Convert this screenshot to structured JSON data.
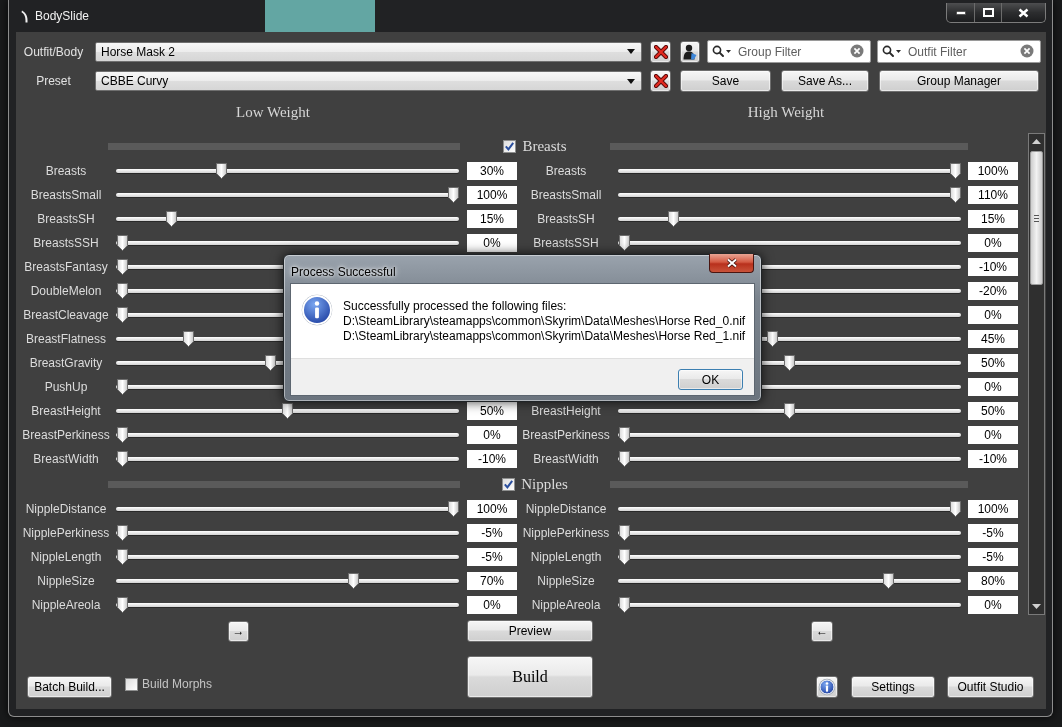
{
  "window": {
    "title": "BodySlide"
  },
  "outfit": {
    "label": "Outfit/Body",
    "value": "Horse Mask 2"
  },
  "filters": [
    {
      "placeholder": "Group Filter"
    },
    {
      "placeholder": "Outfit Filter"
    }
  ],
  "preset": {
    "label": "Preset",
    "value": "CBBE Curvy"
  },
  "preset_buttons": [
    "Save",
    "Save As...",
    "Group Manager"
  ],
  "columns": [
    "Low Weight",
    "High Weight"
  ],
  "categories": [
    {
      "name": "Breasts",
      "checked": true,
      "sliders": [
        {
          "low": {
            "label": "Breasts",
            "value": "30%",
            "level": 0.3
          },
          "high": {
            "label": "Breasts",
            "value": "100%",
            "level": 1
          }
        },
        {
          "low": {
            "label": "BreastsSmall",
            "value": "100%",
            "level": 1
          },
          "high": {
            "label": "BreastsSmall",
            "value": "110%",
            "level": 1
          }
        },
        {
          "low": {
            "label": "BreastsSH",
            "value": "15%",
            "level": 0.15
          },
          "high": {
            "label": "BreastsSH",
            "value": "15%",
            "level": 0.15
          }
        },
        {
          "low": {
            "label": "BreastsSSH",
            "value": "0%",
            "level": 0
          },
          "high": {
            "label": "BreastsSSH",
            "value": "0%",
            "level": 0
          }
        },
        {
          "low": {
            "label": "BreastsFantasy",
            "level": 0
          },
          "high": {
            "value": "-10%"
          }
        },
        {
          "low": {
            "label": "DoubleMelon",
            "level": 0
          },
          "high": {
            "value": "-20%"
          }
        },
        {
          "low": {
            "label": "BreastCleavage",
            "level": 0
          },
          "high": {
            "value": "0%"
          }
        },
        {
          "low": {
            "label": "BreastFlatness",
            "level": 0.2
          },
          "high": {
            "value": "45%",
            "level": 0.45
          }
        },
        {
          "low": {
            "label": "BreastGravity",
            "level": 0.45
          },
          "high": {
            "value": "50%",
            "level": 0.5
          }
        },
        {
          "low": {
            "label": "PushUp",
            "level": 0
          },
          "high": {
            "value": "0%"
          }
        },
        {
          "low": {
            "label": "BreastHeight",
            "value": "50%",
            "level": 0.5
          },
          "high": {
            "label": "BreastHeight",
            "value": "50%",
            "level": 0.5
          }
        },
        {
          "low": {
            "label": "BreastPerkiness",
            "value": "0%",
            "level": 0
          },
          "high": {
            "label": "BreastPerkiness",
            "value": "0%",
            "level": 0
          }
        },
        {
          "low": {
            "label": "BreastWidth",
            "value": "-10%",
            "level": 0
          },
          "high": {
            "label": "BreastWidth",
            "value": "-10%",
            "level": 0
          }
        }
      ]
    },
    {
      "name": "Nipples",
      "checked": true,
      "sliders": [
        {
          "low": {
            "label": "NippleDistance",
            "value": "100%",
            "level": 1
          },
          "high": {
            "label": "NippleDistance",
            "value": "100%",
            "level": 1
          }
        },
        {
          "low": {
            "label": "NipplePerkiness",
            "value": "-5%",
            "level": 0
          },
          "high": {
            "label": "NipplePerkiness",
            "value": "-5%",
            "level": 0
          }
        },
        {
          "low": {
            "label": "NippleLength",
            "value": "-5%",
            "level": 0
          },
          "high": {
            "label": "NippleLength",
            "value": "-5%",
            "level": 0
          }
        },
        {
          "low": {
            "label": "NippleSize",
            "value": "70%",
            "level": 0.7
          },
          "high": {
            "label": "NippleSize",
            "value": "80%",
            "level": 0.8
          }
        },
        {
          "low": {
            "label": "NippleAreola",
            "value": "0%",
            "level": 0
          },
          "high": {
            "label": "NippleAreola",
            "value": "0%",
            "level": 0
          }
        }
      ]
    }
  ],
  "copy_buttons": [
    "→",
    "←"
  ],
  "preview_button": "Preview",
  "batch_build_button": "Batch Build...",
  "build_morphs": {
    "label": "Build Morphs",
    "checked": false
  },
  "build_button": "Build",
  "footer_buttons": [
    "Settings",
    "Outfit Studio"
  ],
  "dialog": {
    "title": "Process Successful",
    "message": [
      "Successfully processed the following files:",
      "D:\\SteamLibrary\\steamapps\\common\\Skyrim\\Data\\Meshes\\Horse Red_0.nif",
      "D:\\SteamLibrary\\steamapps\\common\\Skyrim\\Data\\Meshes\\Horse Red_1.nif"
    ],
    "button": "OK"
  }
}
